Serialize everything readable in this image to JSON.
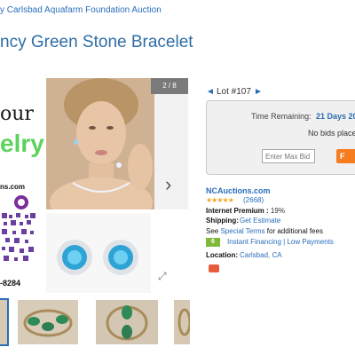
{
  "breadcrumb": "y Carlsbad Aquafarm Foundation Auction",
  "title": "ncy Green Stone Bracelet",
  "promo": {
    "line1": "our",
    "line2": "elry",
    "url": "ns.com",
    "phone": "-8284"
  },
  "gallery": {
    "counter": "2 / 8",
    "next_arrow": "›",
    "expand_icon": "⤢"
  },
  "lot": {
    "label": "Lot #107",
    "prev_icon": "◄",
    "next_icon": "►"
  },
  "bid": {
    "time_label": "Time Remaining:",
    "time_value": "21 Days 20",
    "no_bids": "No bids place",
    "max_bid_placeholder": "Enter Max Bid",
    "button_label": "F"
  },
  "seller": {
    "name": "NCAuctions.com",
    "stars": "★★★★★",
    "reviews": "(2668)",
    "premium_label": "Internet Premium :",
    "premium_value": "19%",
    "shipping_label": "Shipping:",
    "shipping_link": "Get Estimate",
    "terms_prefix": "See",
    "terms_link": "Special Terms",
    "terms_suffix": "for additional fees",
    "financing_badge": "6",
    "financing_text": "Instant Financing | Low Payments",
    "location_label": "Location:",
    "location_value": "Carlsbad, CA"
  },
  "colors": {
    "accent": "#2e6da4",
    "bid_button": "#f57c1f",
    "jade_green": "#2e8b57"
  }
}
